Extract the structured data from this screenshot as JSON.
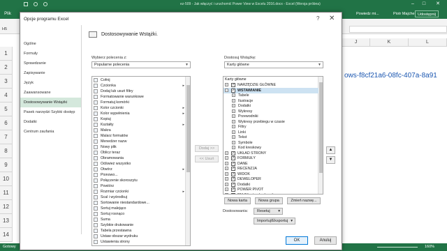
{
  "excel": {
    "title": "ez-509 - Jak włączyć i uruchomić Power View w Excelu 2016.docx - Excel (Wersja próbna)",
    "file_tab": "Plik",
    "tell_me": "Powiedz mi...",
    "user": "Piotr Majcher",
    "share": "Udostępnij",
    "name_box": "H5",
    "columns": [
      "J",
      "K",
      "L"
    ],
    "rows": [
      "1",
      "2",
      "3",
      "4",
      "5",
      "6",
      "7",
      "8",
      "9",
      "10",
      "11",
      "12",
      "13",
      "14"
    ],
    "cell_link": "ows-f8cf21a6-08fc-407a-8a91",
    "status_left": "Gotowy",
    "zoom": "160%",
    "accent": "#217346"
  },
  "dialog": {
    "title": "Opcje programu Excel",
    "help": "?",
    "close": "✕",
    "nav": [
      {
        "label": "Ogólne"
      },
      {
        "label": "Formuły"
      },
      {
        "label": "Sprawdzanie"
      },
      {
        "label": "Zapisywanie"
      },
      {
        "label": "Język"
      },
      {
        "label": "Zaawansowane"
      },
      {
        "label": "Dostosowywanie Wstążki"
      },
      {
        "label": "Pasek narzędzi Szybki dostęp"
      },
      {
        "label": "Dodatki"
      },
      {
        "label": "Centrum zaufania"
      }
    ],
    "heading": "Dostosowywanie Wstążki.",
    "choose_label": "Wybierz polecenia z:",
    "choose_value": "Popularne polecenia",
    "customize_label": "Dostosuj Wstążkę:",
    "customize_value": "Karty główne",
    "commands": [
      "Cofnij",
      "Czcionka",
      "Dodaj lub usuń filtry",
      "Formatowanie warunkowe",
      "Formatuj komórki",
      "Kolor czcionki",
      "Kolor wypełnienia",
      "Kopiuj",
      "Kształty",
      "Makra",
      "Malarz formatów",
      "Menedżer nazw",
      "Nowy plik",
      "Oblicz teraz",
      "Obramowania",
      "Odśwież wszystko",
      "Otwórz",
      "Pionowo...",
      "Połączenie skoroszytu",
      "Powtórz",
      "Rozmiar czcionki",
      "Scal i wyśrodkuj",
      "Sortowanie niestandardowe...",
      "Sortuj malejąco",
      "Sortuj rosnąco",
      "Suma",
      "Szybkie drukowanie",
      "Tabela przestawna",
      "Ustaw obszar wydruku",
      "Ustawienia strony"
    ],
    "add_button": "Dodaj >>",
    "remove_button": "<< Usuń",
    "tree_header": "Karty główne",
    "tree": [
      {
        "label": "NARZĘDZIE GŁÓWNE",
        "level": 0,
        "exp": "+",
        "checked": true
      },
      {
        "label": "WSTAWIANIE",
        "level": 0,
        "exp": "−",
        "checked": true,
        "selected": true
      },
      {
        "label": "Tabele",
        "level": 1,
        "exp": "+"
      },
      {
        "label": "Ilustracje",
        "level": 1,
        "exp": "+"
      },
      {
        "label": "Dodatki",
        "level": 1,
        "exp": "+"
      },
      {
        "label": "Wykresy",
        "level": 1,
        "exp": "+"
      },
      {
        "label": "Przewodniki",
        "level": 1,
        "exp": "+"
      },
      {
        "label": "Wykresy przebiegu w czasie",
        "level": 1,
        "exp": "+"
      },
      {
        "label": "Filtry",
        "level": 1,
        "exp": "+"
      },
      {
        "label": "Linki",
        "level": 1,
        "exp": "+"
      },
      {
        "label": "Tekst",
        "level": 1,
        "exp": "+"
      },
      {
        "label": "Symbole",
        "level": 1,
        "exp": "+"
      },
      {
        "label": "Kod kreskowy",
        "level": 1,
        "exp": "+"
      },
      {
        "label": "UKŁAD STRONY",
        "level": 0,
        "exp": "+",
        "checked": true
      },
      {
        "label": "FORMUŁY",
        "level": 0,
        "exp": "+",
        "checked": true
      },
      {
        "label": "DANE",
        "level": 0,
        "exp": "+",
        "checked": true
      },
      {
        "label": "RECENZJA",
        "level": 0,
        "exp": "+",
        "checked": true
      },
      {
        "label": "WIDOK",
        "level": 0,
        "exp": "+",
        "checked": true
      },
      {
        "label": "DEWELOPER",
        "level": 0,
        "exp": "+",
        "checked": true
      },
      {
        "label": "Dodatki",
        "level": 0,
        "exp": "+",
        "checked": true
      },
      {
        "label": "POWER PIVOT",
        "level": 0,
        "exp": "+",
        "checked": true
      },
      {
        "label": "PM (Niestandardowa)",
        "level": 0,
        "exp": "+",
        "checked": true
      }
    ],
    "new_tab": "Nowa karta",
    "new_group": "Nowa grupa",
    "rename": "Zmień nazwę...",
    "customizations_label": "Dostosowania:",
    "reset": "Resetuj",
    "import_export": "Importuj/Eksportuj",
    "ok": "OK",
    "cancel": "Anuluj"
  }
}
